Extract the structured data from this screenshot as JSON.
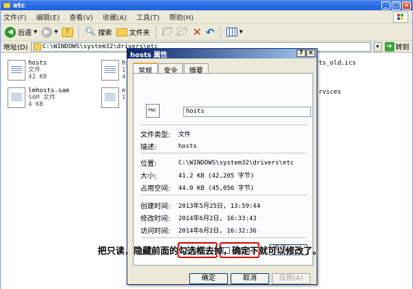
{
  "window": {
    "title": "etc"
  },
  "menubar": {
    "items": [
      "文件(F)",
      "编辑(E)",
      "查看(V)",
      "收藏(A)",
      "工具(T)",
      "帮助(H)"
    ]
  },
  "toolbar": {
    "back": "后退",
    "search": "搜索",
    "folders": "文件夹"
  },
  "addressbar": {
    "label": "地址(D)",
    "path": "C:\\WINDOWS\\system32\\drivers\\etc",
    "go": "转到"
  },
  "files": [
    {
      "name": "hosts",
      "type": "文件",
      "size": "42 KB"
    },
    {
      "name": "lmhosts.sam",
      "type": "SAM 文件",
      "size": "4 KB"
    }
  ],
  "clipped": {
    "r1a": "h",
    "r1b": "1",
    "r1c": "4",
    "r2a": "n",
    "r2b": "1",
    "ics": "ts_old.ics",
    "svc": "rvices"
  },
  "dialog": {
    "title": "hosts 属性",
    "tabs": [
      "常规",
      "安全",
      "摘要"
    ],
    "icon_text": "PAD",
    "filename": "hosts",
    "rows": {
      "type": {
        "label": "文件类型:",
        "value": "文件"
      },
      "desc": {
        "label": "描述:",
        "value": "hosts"
      },
      "location": {
        "label": "位置:",
        "value": "C:\\WINDOWS\\system32\\drivers\\etc"
      },
      "size": {
        "label": "大小:",
        "value": "41.2 KB (42,205 字节)"
      },
      "disk": {
        "label": "占用空间:",
        "value": "44.0 KB (45,056 字节)"
      },
      "created": {
        "label": "创建时间:",
        "value": "2013年5月25日, 13:59:44"
      },
      "modified": {
        "label": "修改时间:",
        "value": "2014年6月2日, 16:33:43"
      },
      "accessed": {
        "label": "访问时间:",
        "value": "2014年6月2日, 16:32:36"
      }
    },
    "attributes": {
      "label": "属性:",
      "readonly": "只读(R)",
      "hidden": "隐藏(H)",
      "advanced": "高级(D)..."
    },
    "buttons": {
      "ok": "确定",
      "cancel": "取消",
      "apply": "应用(A)"
    }
  },
  "caption": "把只读，隐藏前面的勾选框去掉，确定下就可以修改了。"
}
